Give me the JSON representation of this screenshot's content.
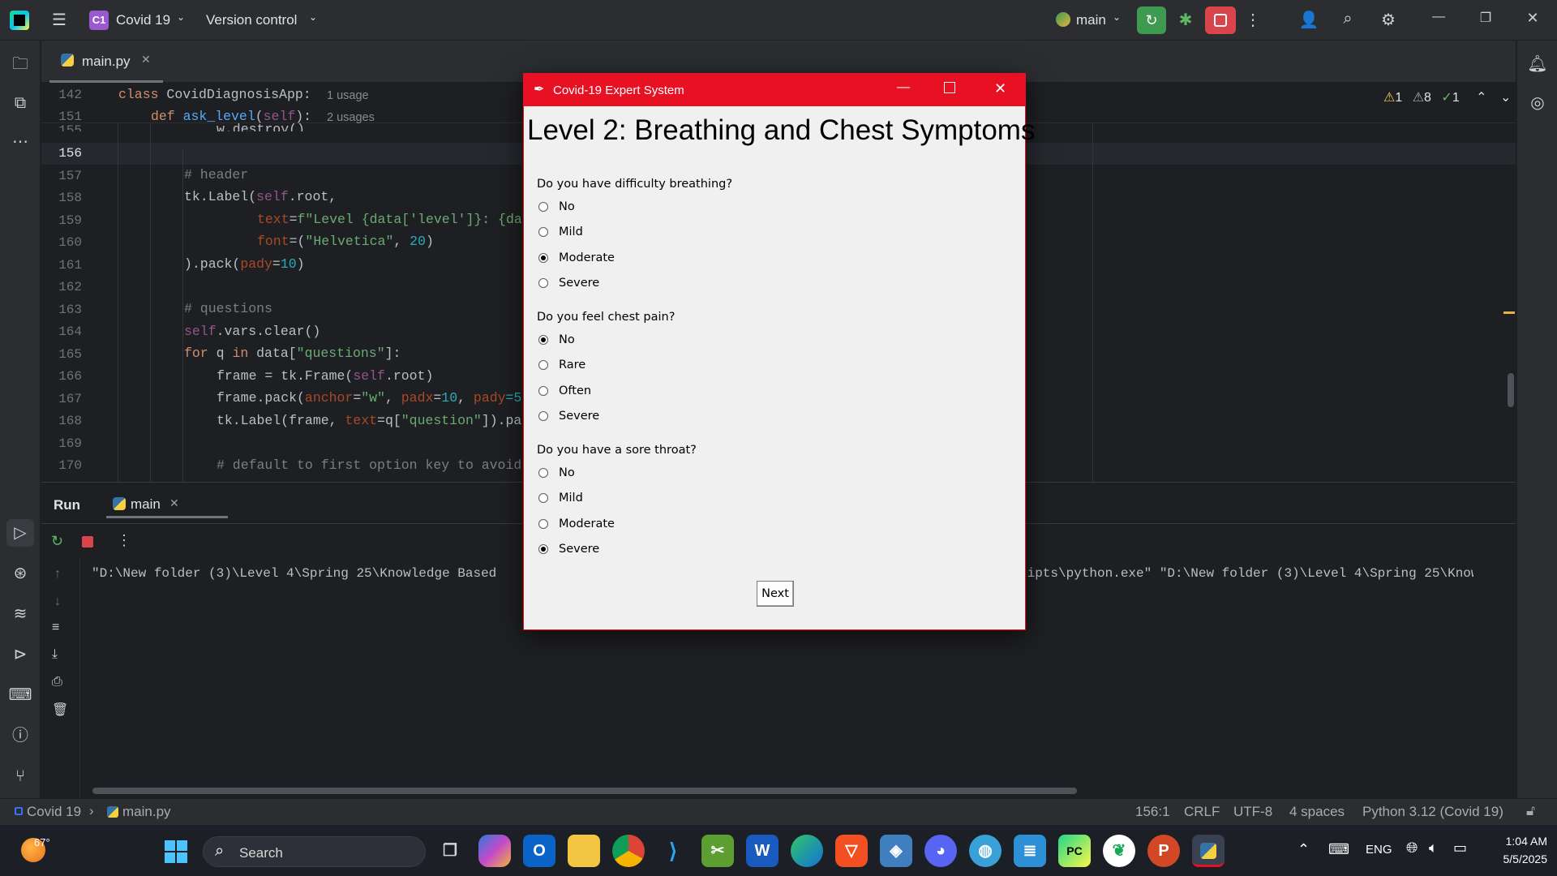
{
  "ide": {
    "project_badge": "C1",
    "project_name": "Covid 19",
    "vcs": "Version control",
    "branch": "main",
    "tab_file": "main.py",
    "breadcrumb_class": "class CovidDiagnosisApp:",
    "breadcrumb_class_usage": "1 usage",
    "breadcrumb_def_kw": "def",
    "breadcrumb_def_name": "ask_level",
    "breadcrumb_def_args": "(self):",
    "breadcrumb_def_usage": "2 usages",
    "line_142": "142",
    "line_151": "151",
    "line_155": "155",
    "inspections": {
      "warnings": "1",
      "weak": "8",
      "ok": "1"
    },
    "code_lines": [
      {
        "n": "156",
        "t": ""
      },
      {
        "n": "157",
        "t": ""
      },
      {
        "n": "158",
        "t": ""
      },
      {
        "n": "159",
        "t": ""
      },
      {
        "n": "160",
        "t": ""
      },
      {
        "n": "161",
        "t": ""
      },
      {
        "n": "162",
        "t": ""
      },
      {
        "n": "163",
        "t": ""
      },
      {
        "n": "164",
        "t": ""
      },
      {
        "n": "165",
        "t": ""
      },
      {
        "n": "166",
        "t": ""
      },
      {
        "n": "167",
        "t": ""
      },
      {
        "n": "168",
        "t": ""
      },
      {
        "n": "169",
        "t": ""
      },
      {
        "n": "170",
        "t": ""
      }
    ],
    "code_155": "w.destroy()",
    "code_157": "# header",
    "code_158a": "tk.Label(",
    "code_158b": "self",
    "code_158c": ".root,",
    "code_159a": "text",
    "code_159b": "=",
    "code_159c": "f\"Level {data[",
    "code_159d": "'level'",
    "code_159e": "]}: {da",
    "code_160a": "font",
    "code_160b": "=(",
    "code_160c": "\"Helvetica\"",
    "code_160d": ", ",
    "code_160e": "20",
    "code_160f": ")",
    "code_161a": ").pack(",
    "code_161b": "pady",
    "code_161c": "=",
    "code_161d": "10",
    "code_161e": ")",
    "code_163": "# questions",
    "code_164a": "self",
    "code_164b": ".vars.clear()",
    "code_165a": "for",
    "code_165b": " q ",
    "code_165c": "in",
    "code_165d": " data[",
    "code_165e": "\"questions\"",
    "code_165f": "]:",
    "code_166a": "frame = tk.Frame(",
    "code_166b": "self",
    "code_166c": ".root)",
    "code_167a": "frame.pack(",
    "code_167b": "anchor",
    "code_167c": "=",
    "code_167d": "\"w\"",
    "code_167e": ", ",
    "code_167f": "padx",
    "code_167g": "=",
    "code_167h": "10",
    "code_167i": ", ",
    "code_167j": "pady",
    "code_167k": "=5",
    "code_168a": "tk.Label(frame, ",
    "code_168b": "text",
    "code_168c": "=q[",
    "code_168d": "\"question\"",
    "code_168e": "]).pa",
    "code_170": "# default to first option key to avoid",
    "run_label": "Run",
    "run_tab": "main",
    "console_left": "\"D:\\New folder (3)\\Level 4\\Spring 25\\Knowledge Based",
    "console_right": "ripts\\python.exe\" \"D:\\New folder (3)\\Level 4\\Spring 25\\Knowle",
    "status": {
      "project": "Covid 19",
      "file": "main.py",
      "position": "156:1",
      "line_sep": "CRLF",
      "encoding": "UTF-8",
      "indent": "4 spaces",
      "interpreter": "Python 3.12 (Covid 19)"
    }
  },
  "tkwindow": {
    "title": "Covid-19 Expert System",
    "heading": "Level 2: Breathing and Chest Symptoms",
    "questions": [
      {
        "text": "Do you have difficulty breathing?",
        "options": [
          "No",
          "Mild",
          "Moderate",
          "Severe"
        ],
        "selected": 2
      },
      {
        "text": "Do you feel chest pain?",
        "options": [
          "No",
          "Rare",
          "Often",
          "Severe"
        ],
        "selected": 0
      },
      {
        "text": "Do you have a sore throat?",
        "options": [
          "No",
          "Mild",
          "Moderate",
          "Severe"
        ],
        "selected": 3
      }
    ],
    "next_label": "Next"
  },
  "taskbar": {
    "weather": "67°",
    "search_placeholder": "Search",
    "lang": "ENG",
    "time": "1:04 AM",
    "date": "5/5/2025"
  },
  "colors": {
    "accent_red": "#e81123",
    "ide_bg": "#1e1f22",
    "panel_bg": "#2b2d30",
    "run_green": "#3d9a50"
  }
}
